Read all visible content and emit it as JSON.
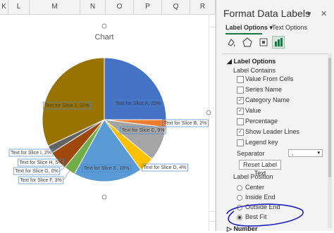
{
  "sheet": {
    "columns": [
      "L",
      "M",
      "N",
      "O",
      "P",
      "Q",
      "R"
    ],
    "left_partial_column": "K"
  },
  "chart": {
    "title": "Chart",
    "labels": [
      "Text for Slice A, 25%",
      "Text for Slice B, 2%",
      "Text for Slice C, 9%",
      "Text for Slice D, 4%",
      "Text for Slice E, 18%",
      "Text for Slice F, 3%",
      "Text for Slice G, 0%",
      "Text for Slice H, 5%",
      "Text for Slice I, 2%",
      "Text for Slice J, 32%"
    ]
  },
  "chart_data": {
    "type": "pie",
    "title": "Chart",
    "categories": [
      "Slice A",
      "Slice B",
      "Slice C",
      "Slice D",
      "Slice E",
      "Slice F",
      "Slice G",
      "Slice H",
      "Slice I",
      "Slice J"
    ],
    "values": [
      25,
      2,
      9,
      4,
      18,
      3,
      0,
      5,
      2,
      32
    ],
    "colors": [
      "#4472c4",
      "#ed7d31",
      "#a5a5a5",
      "#ffc000",
      "#5b9bd5",
      "#70ad47",
      "#264478",
      "#9e480e",
      "#636363",
      "#997300"
    ],
    "legend": "none"
  },
  "pane": {
    "title": "Format Data Labels",
    "tab_label_options": "Label Options",
    "tab_text_options": "Text Options",
    "section_label_options": "Label Options",
    "label_contains": "Label Contains",
    "checkboxes": [
      {
        "label": "Value From Cells",
        "checked": false
      },
      {
        "label": "Series Name",
        "checked": false
      },
      {
        "label": "Category Name",
        "checked": true
      },
      {
        "label": "Value",
        "checked": true
      },
      {
        "label": "Percentage",
        "checked": false
      },
      {
        "label": "Show Leader Lines",
        "checked": true
      },
      {
        "label": "Legend key",
        "checked": false
      }
    ],
    "separator_label": "Separator",
    "separator_value": ",",
    "reset_button": "Reset Label Text",
    "label_position": "Label Position",
    "positions": [
      {
        "label": "Center",
        "selected": false
      },
      {
        "label": "Inside End",
        "selected": false
      },
      {
        "label": "Outside End",
        "selected": false
      },
      {
        "label": "Best Fit",
        "selected": true
      }
    ],
    "number_section": "Number",
    "dropdown_icon": "chevron-down-icon",
    "close_icon": "close-icon",
    "accent_color": "#217346",
    "annotation_color": "#1f1fc2"
  }
}
